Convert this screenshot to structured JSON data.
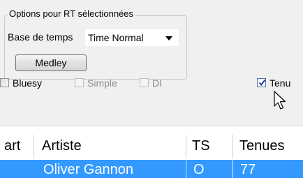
{
  "options_group": {
    "title": "Options pour RT sélectionnées",
    "base_label": "Base de temps",
    "time_select_value": "Time Normal",
    "medley_label": "Medley"
  },
  "checkboxes": {
    "bluesy": {
      "label": "Bluesy",
      "checked": false,
      "enabled": true
    },
    "simple": {
      "label": "Simple",
      "checked": false,
      "enabled": false
    },
    "dl": {
      "label": "DI",
      "checked": false,
      "enabled": false
    },
    "tenu": {
      "label": "Tenu",
      "checked": true,
      "enabled": true
    }
  },
  "table": {
    "columns": [
      "art",
      "Artiste",
      "TS",
      "Tenues"
    ],
    "rows": [
      {
        "artiste": "Oliver Gannon",
        "ts": "O",
        "tenues": "77",
        "selected": true
      }
    ]
  },
  "colors": {
    "selection": "#3399ff",
    "panel": "#f0f0f0"
  }
}
